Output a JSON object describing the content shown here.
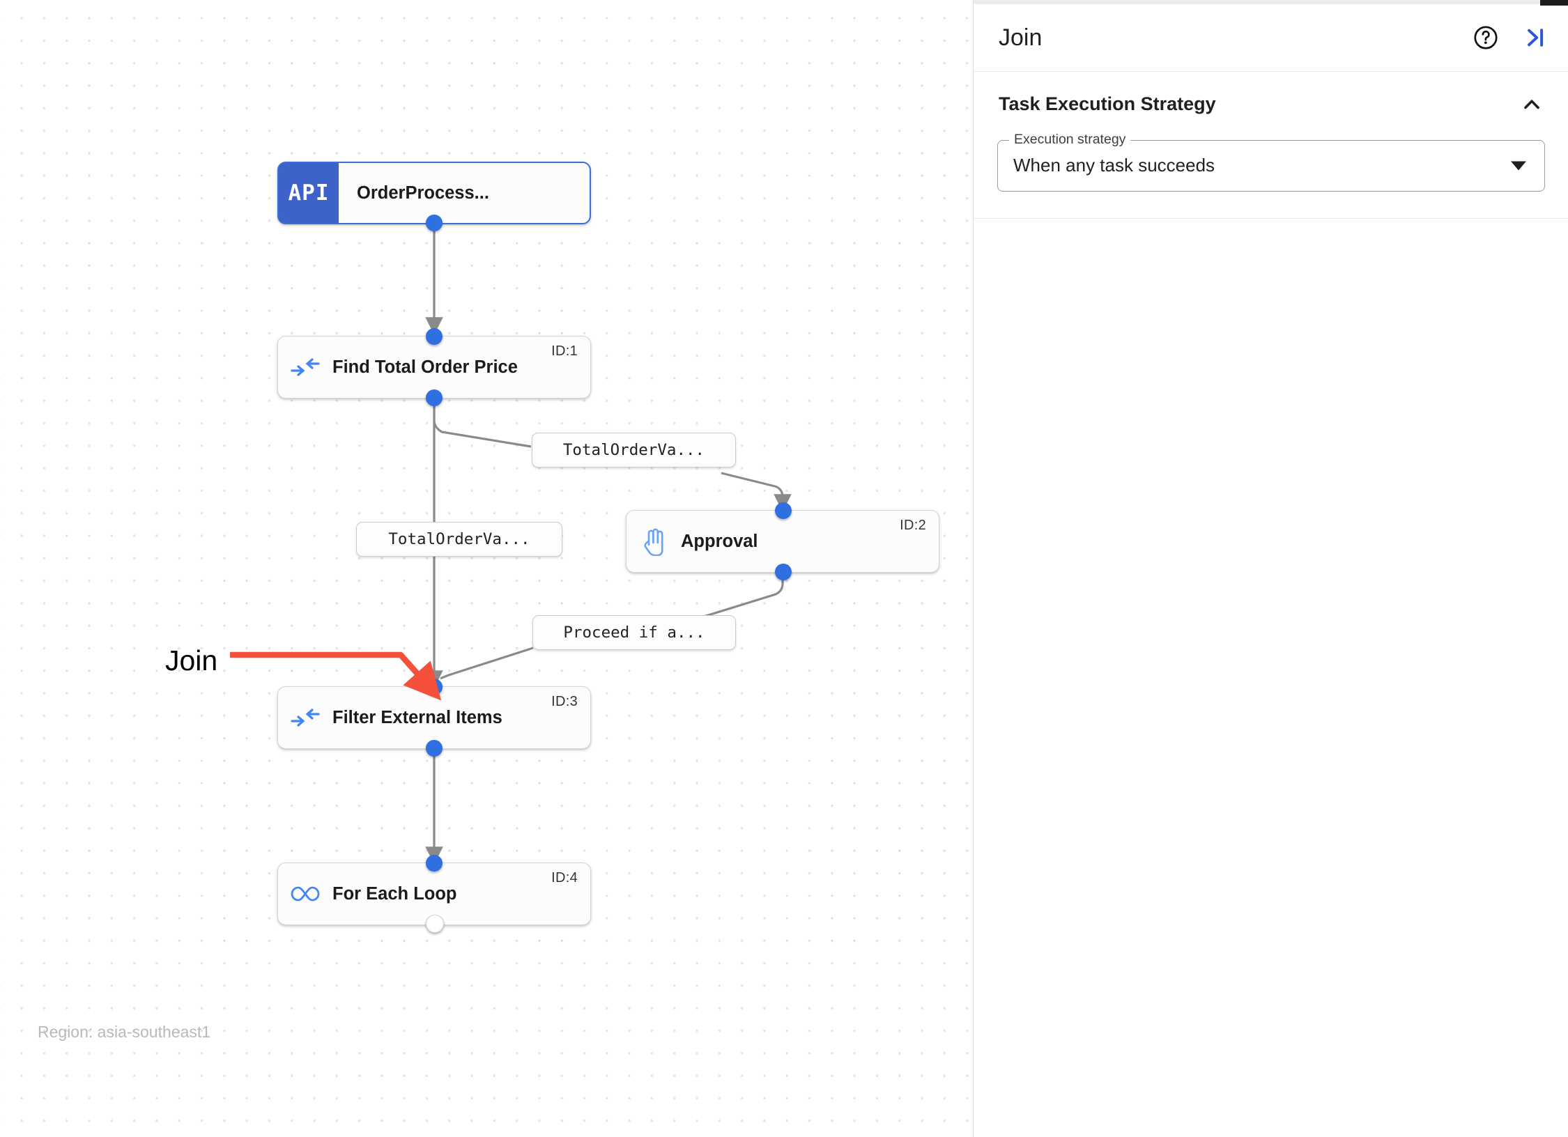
{
  "panel": {
    "title": "Join",
    "help_icon": "help-circle-icon",
    "collapse_icon": "collapse-panel-right-icon",
    "section": {
      "title": "Task Execution Strategy",
      "collapse_icon": "chevron-up-icon",
      "field": {
        "legend": "Execution strategy",
        "value": "When any task succeeds",
        "caret_icon": "caret-down-icon",
        "options": [
          "When any task succeeds"
        ]
      }
    }
  },
  "canvas": {
    "region_label": "Region: asia-southeast1",
    "annotation": {
      "label": "Join",
      "color": "#f4503c"
    },
    "accent_port_color": "#2f6fe0",
    "edge_color": "#8a8a8a",
    "nodes": [
      {
        "id": "",
        "title": "OrderProcess...",
        "badge": "API",
        "icon": "api-badge",
        "selected": true
      },
      {
        "id": "ID:1",
        "title": "Find Total Order Price",
        "icon": "merge-arrows-icon",
        "selected": false
      },
      {
        "id": "ID:2",
        "title": "Approval",
        "icon": "hand-raised-icon",
        "selected": false
      },
      {
        "id": "ID:3",
        "title": "Filter External Items",
        "icon": "merge-arrows-icon",
        "selected": false
      },
      {
        "id": "ID:4",
        "title": "For Each Loop",
        "icon": "infinity-loop-icon",
        "selected": false
      }
    ],
    "edge_labels": [
      {
        "text": "TotalOrderVa..."
      },
      {
        "text": "TotalOrderVa..."
      },
      {
        "text": "Proceed if a..."
      }
    ]
  }
}
